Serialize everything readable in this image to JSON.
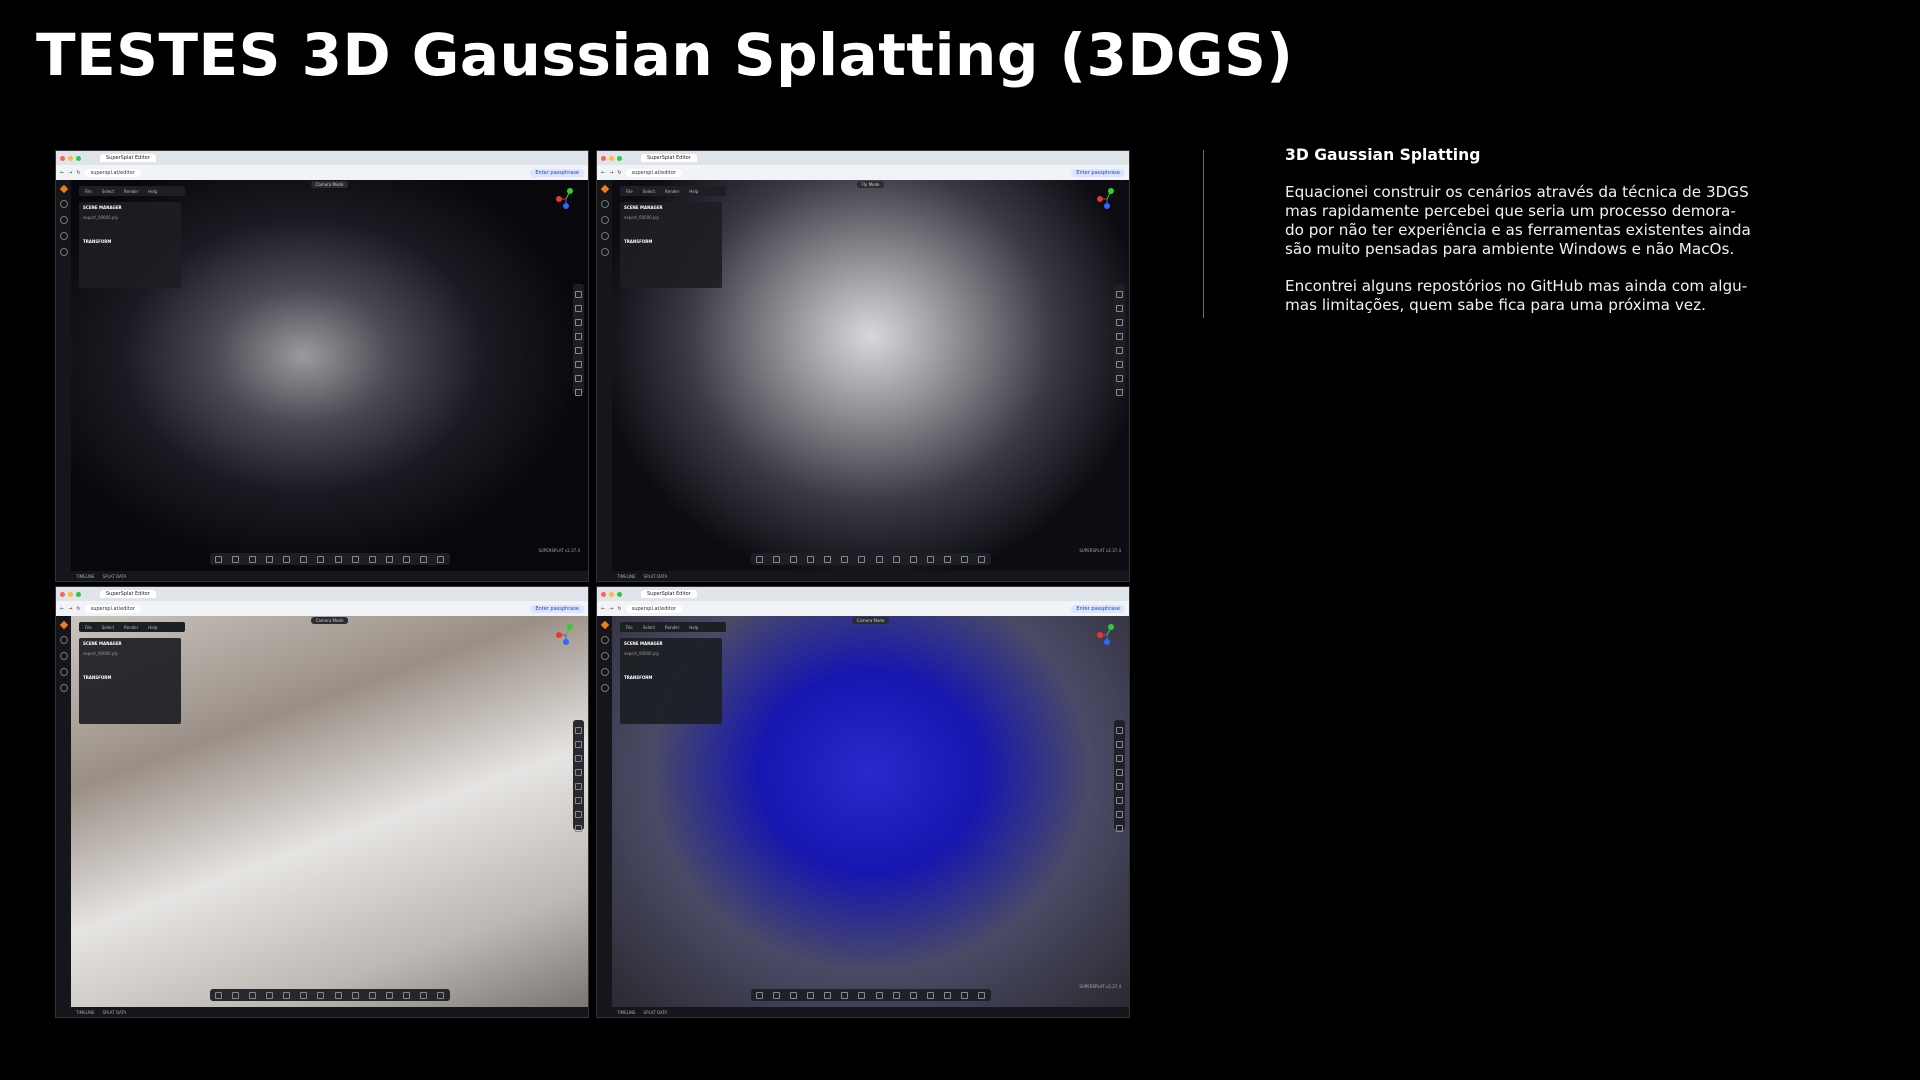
{
  "title": "TESTES 3D Gaussian Splatting (3DGS)",
  "description": {
    "heading": "3D Gaussian Splatting",
    "paragraph1": "Equacionei construir os cenários através da técnica de 3DGS\nmas rapidamente percebei que seria um processo demora-\ndo por não ter experiência e as ferramentas existentes ainda\nsão muito pensadas para ambiente Windows e não MacOs.",
    "paragraph2": "Encontrei alguns repostórios no GitHub mas ainda com algu-\nmas limitações, quem sabe fica para uma próxima vez."
  },
  "screenshots": [
    {
      "tab": "SuperSplat Editor",
      "url": "superspl.at/editor",
      "incognito": "Enter passphrase",
      "menu": [
        "File",
        "Select",
        "Render",
        "Help"
      ],
      "panel_title": "SCENE MANAGER",
      "file": "export_00000.ply",
      "transform": "TRANSFORM",
      "chip": "Camera Mode",
      "status_left": [
        "TIMELINE",
        "SPLAT DATA"
      ],
      "watermark": "SUPERSPLAT v2.37.4"
    },
    {
      "tab": "SuperSplat Editor",
      "url": "superspl.at/editor",
      "incognito": "Enter passphrase",
      "menu": [
        "File",
        "Select",
        "Render",
        "Help"
      ],
      "panel_title": "SCENE MANAGER",
      "file": "export_00000.ply",
      "transform": "TRANSFORM",
      "chip": "Fly Mode",
      "status_left": [
        "TIMELINE",
        "SPLAT DATA"
      ],
      "watermark": "SUPERSPLAT v2.37.4"
    },
    {
      "tab": "SuperSplat Editor",
      "url": "superspl.at/editor",
      "incognito": "Enter passphrase",
      "menu": [
        "File",
        "Select",
        "Render",
        "Help"
      ],
      "panel_title": "SCENE MANAGER",
      "file": "export_00000.ply",
      "transform": "TRANSFORM",
      "chip": "Camera Mode",
      "status_left": [
        "TIMELINE",
        "SPLAT DATA"
      ],
      "watermark": ""
    },
    {
      "tab": "SuperSplat Editor",
      "url": "superspl.at/editor",
      "incognito": "Enter passphrase",
      "menu": [
        "File",
        "Select",
        "Render",
        "Help"
      ],
      "panel_title": "SCENE MANAGER",
      "file": "export_00000.ply",
      "transform": "TRANSFORM",
      "chip": "Camera Mode",
      "status_left": [
        "TIMELINE",
        "SPLAT DATA"
      ],
      "watermark": "SUPERSPLAT v2.37.4"
    }
  ],
  "colors": {
    "accent": "#f07c1c",
    "background": "#000000",
    "point_blue": "#1a1aff"
  }
}
